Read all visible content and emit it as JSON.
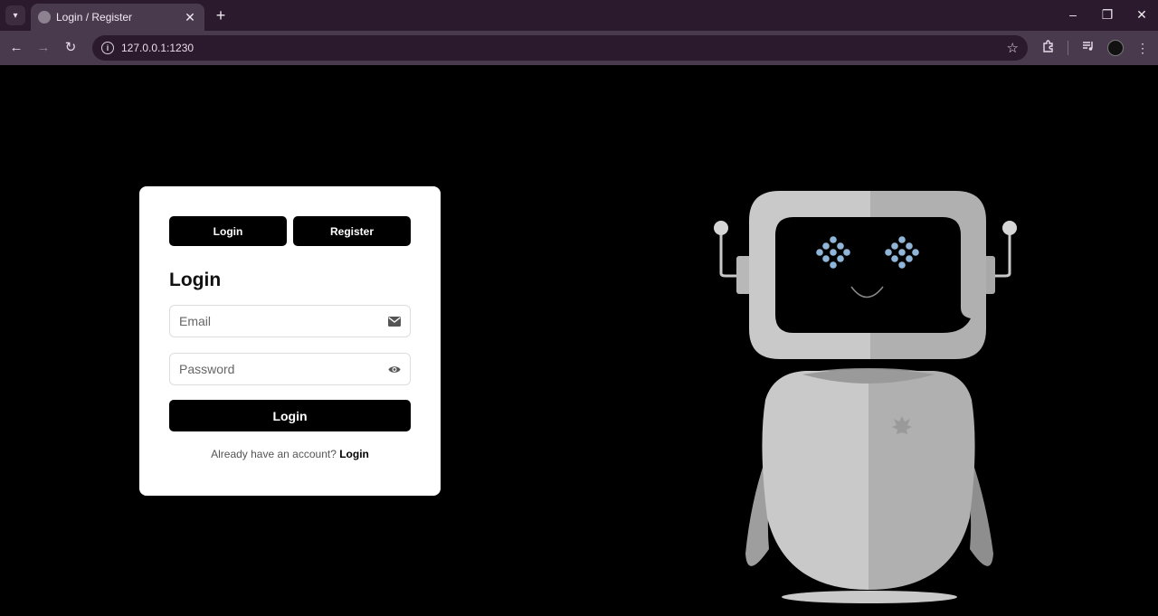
{
  "browser": {
    "tab_title": "Login / Register",
    "url": "127.0.0.1:1230",
    "new_tab": "+",
    "close": "✕"
  },
  "icons": {
    "tab_search": "chevron-down-icon",
    "back": "back-arrow-icon",
    "forward": "forward-arrow-icon",
    "reload": "reload-icon",
    "site_info": "info-icon",
    "bookmark": "star-icon",
    "extensions": "puzzle-icon",
    "media": "media-control-icon",
    "menu": "kebab-menu-icon",
    "email": "envelope-icon",
    "password": "eye-icon"
  },
  "auth": {
    "login_tab": "Login",
    "register_tab": "Register",
    "title": "Login",
    "email_placeholder": "Email",
    "password_placeholder": "Password",
    "submit": "Login",
    "switch_prompt": "Already have an account?",
    "switch_link": "Login"
  },
  "colors": {
    "background": "#000000",
    "card": "#ffffff",
    "button": "#000000",
    "chrome_dark": "#2b1a2d",
    "chrome_light": "#4a3a4e",
    "robot_light": "#c9c9c9",
    "robot_shade": "#b0b0b0",
    "robot_eyes": "#8fb6d9"
  }
}
